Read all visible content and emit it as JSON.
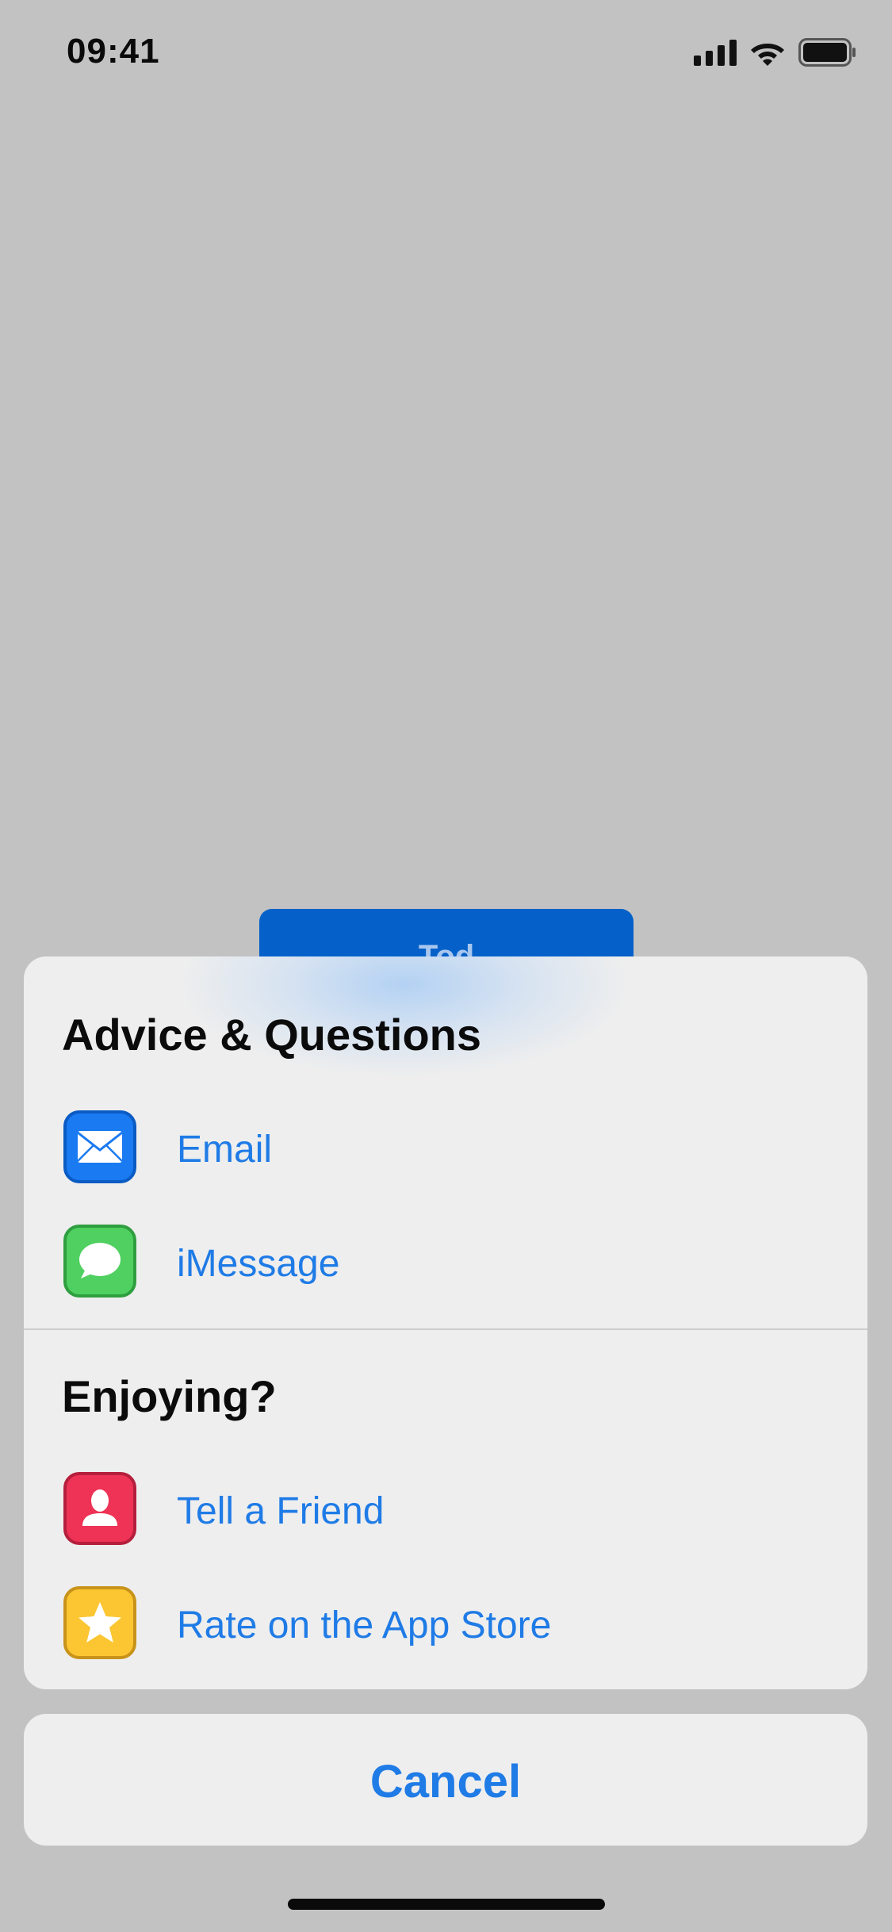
{
  "status_bar": {
    "time": "09:41"
  },
  "background": {
    "button_label": "Tod"
  },
  "sheet": {
    "sections": [
      {
        "title": "Advice & Questions",
        "items": [
          {
            "label": "Email",
            "icon": "envelope-icon"
          },
          {
            "label": "iMessage",
            "icon": "speech-bubble-icon"
          }
        ]
      },
      {
        "title": "Enjoying?",
        "items": [
          {
            "label": "Tell a Friend",
            "icon": "person-icon"
          },
          {
            "label": "Rate on the App Store",
            "icon": "star-icon"
          }
        ]
      }
    ]
  },
  "cancel": {
    "label": "Cancel"
  },
  "colors": {
    "accent": "#1f7be6",
    "sheet_bg": "#eeeeee",
    "page_bg": "#c2c2c2"
  }
}
